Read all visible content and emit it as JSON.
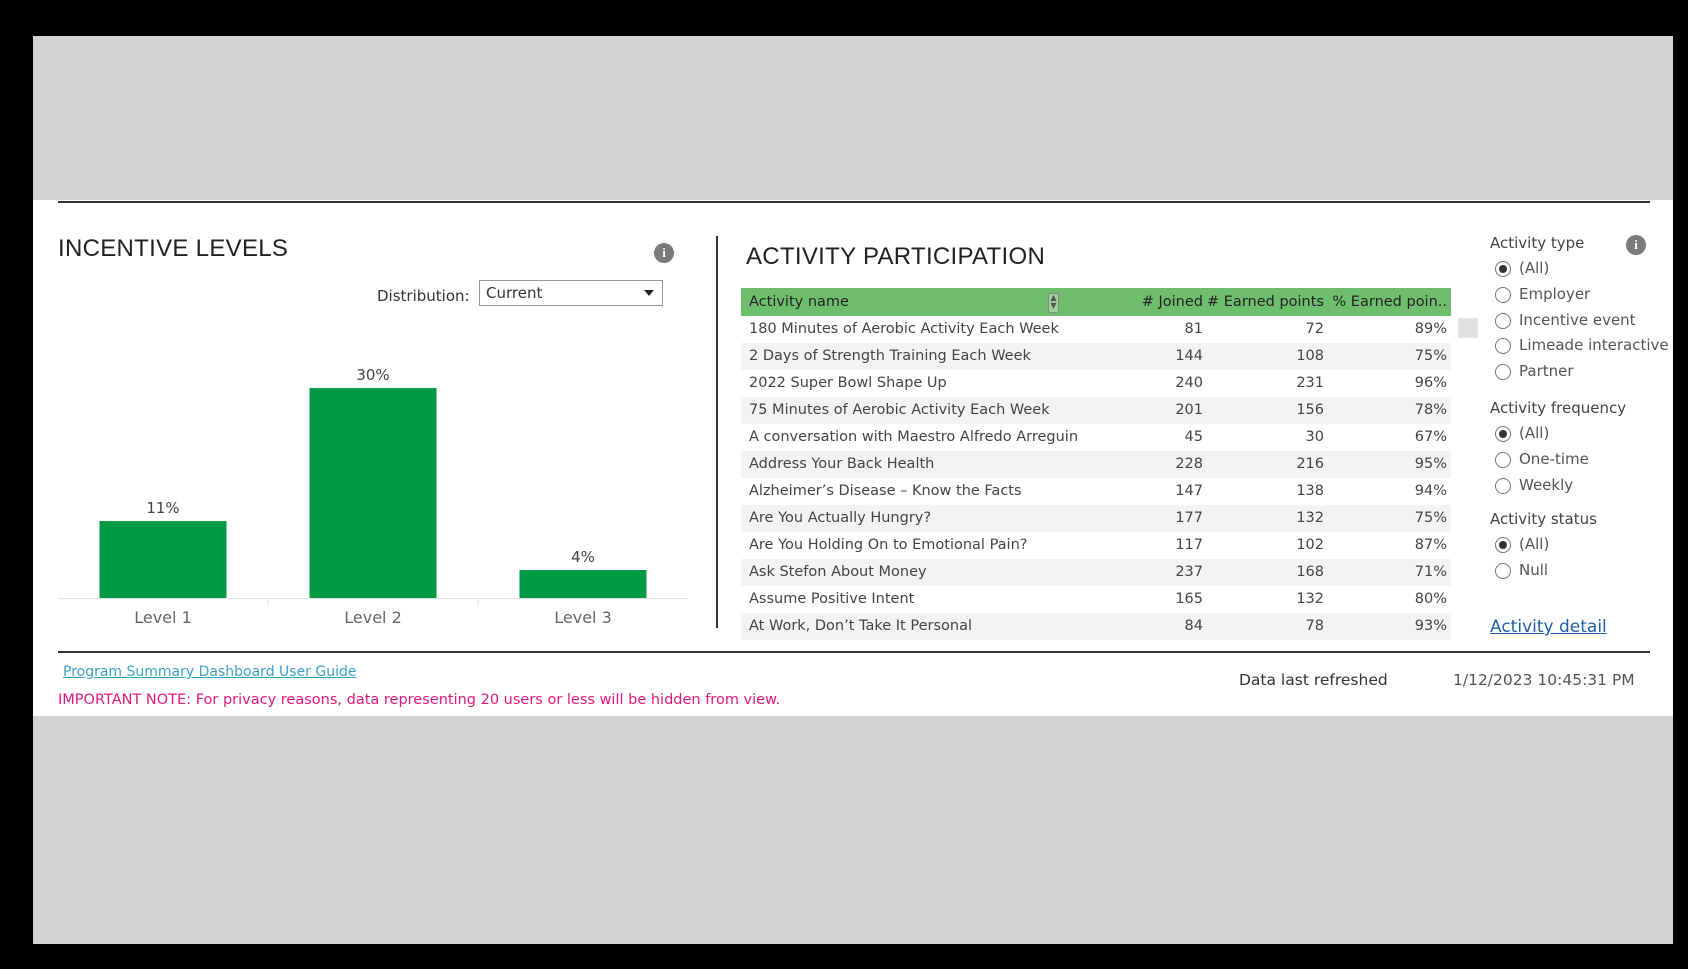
{
  "incentive_levels": {
    "title": "INCENTIVE LEVELS",
    "distribution_label": "Distribution:",
    "distribution_value": "Current"
  },
  "chart_data": {
    "type": "bar",
    "categories": [
      "Level 1",
      "Level 2",
      "Level 3"
    ],
    "values": [
      11,
      30,
      4
    ],
    "value_labels": [
      "11%",
      "30%",
      "4%"
    ],
    "ylim": [
      0,
      40
    ],
    "grid": false,
    "bar_color": "#009a44"
  },
  "activity_participation": {
    "title": "ACTIVITY PARTICIPATION",
    "columns": [
      "Activity name",
      "# Joined",
      "# Earned points",
      "% Earned poin.."
    ],
    "header_color": "#6ebe6e",
    "rows": [
      [
        "180 Minutes of Aerobic Activity Each Week",
        "81",
        "72",
        "89%"
      ],
      [
        "2 Days of Strength Training Each Week",
        "144",
        "108",
        "75%"
      ],
      [
        "2022 Super Bowl Shape Up",
        "240",
        "231",
        "96%"
      ],
      [
        "75 Minutes of Aerobic Activity Each Week",
        "201",
        "156",
        "78%"
      ],
      [
        "A conversation with Maestro Alfredo Arreguin",
        "45",
        "30",
        "67%"
      ],
      [
        "Address Your Back Health",
        "228",
        "216",
        "95%"
      ],
      [
        "Alzheimer’s Disease – Know the Facts",
        "147",
        "138",
        "94%"
      ],
      [
        "Are You Actually Hungry?",
        "177",
        "132",
        "75%"
      ],
      [
        "Are You Holding On to Emotional Pain?",
        "117",
        "102",
        "87%"
      ],
      [
        "Ask Stefon About Money",
        "237",
        "168",
        "71%"
      ],
      [
        "Assume Positive Intent",
        "165",
        "132",
        "80%"
      ],
      [
        "At Work, Don’t Take It Personal",
        "84",
        "78",
        "93%"
      ]
    ]
  },
  "filters": {
    "activity_type": {
      "title": "Activity type",
      "options": [
        "(All)",
        "Employer",
        "Incentive event",
        "Limeade interactive",
        "Partner"
      ],
      "selected": "(All)"
    },
    "activity_frequency": {
      "title": "Activity frequency",
      "options": [
        "(All)",
        "One-time",
        "Weekly"
      ],
      "selected": "(All)"
    },
    "activity_status": {
      "title": "Activity status",
      "options": [
        "(All)",
        "Null"
      ],
      "selected": "(All)"
    },
    "detail_link": "Activity detail"
  },
  "footer": {
    "guide_link": "Program Summary Dashboard User Guide",
    "note": "IMPORTANT NOTE: For privacy reasons, data representing 20 users or less will be hidden from view.",
    "refreshed_label": "Data last refreshed",
    "refreshed_value": "1/12/2023 10:45:31 PM",
    "note_color": "#e0197d",
    "link_color": "#3aa3c8"
  },
  "icons": {
    "info": "info-icon",
    "sort": "sort-icon",
    "dropdown": "chevron-down-icon"
  }
}
